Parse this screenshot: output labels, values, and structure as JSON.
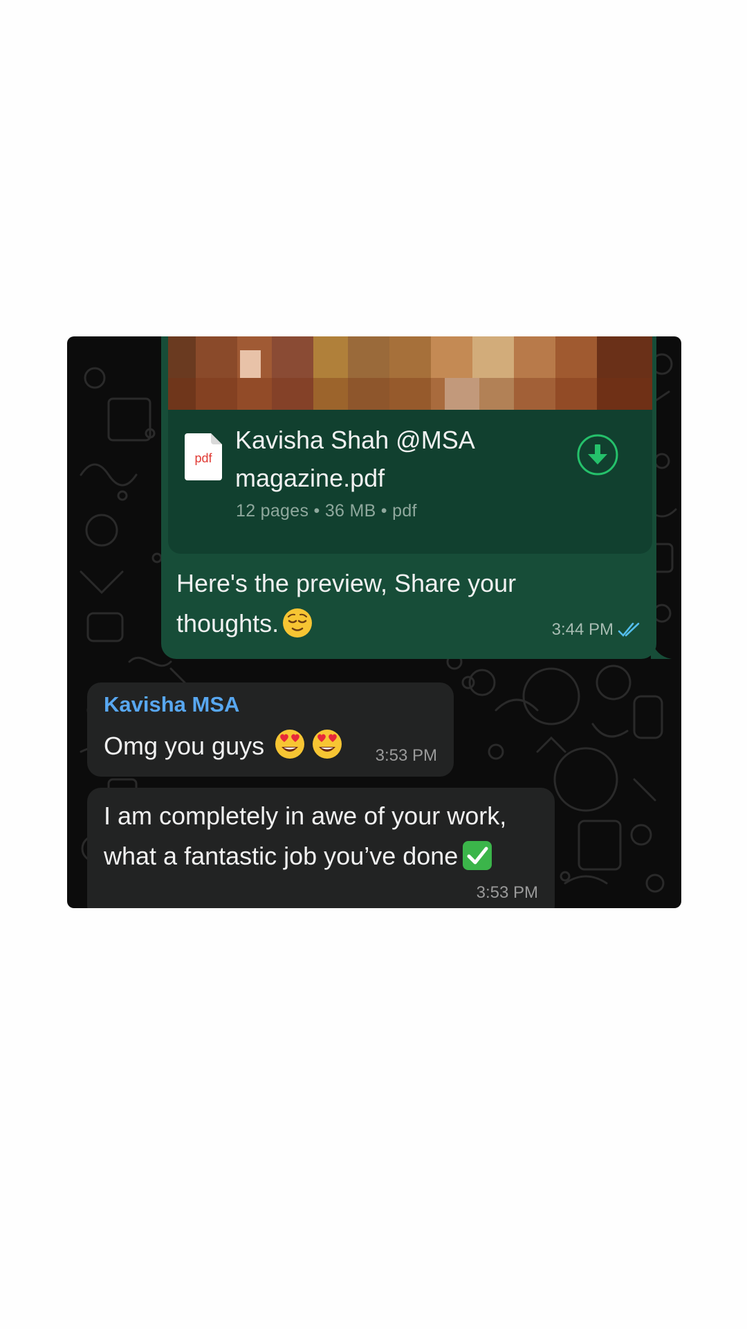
{
  "chat": {
    "outgoing_document": {
      "file_name": "Kavisha Shah @MSA magazine.pdf",
      "file_type_label": "pdf",
      "meta": "12 pages • 36 MB • pdf",
      "caption": "Here's the preview, Share your thoughts.",
      "caption_emoji": "relieved-face",
      "time": "3:44 PM",
      "status": "read",
      "download_icon": "download-arrow-icon"
    },
    "incoming": [
      {
        "sender": "Kavisha MSA",
        "text": "Omg you guys",
        "emojis": [
          "heart-eyes-face",
          "heart-eyes-face"
        ],
        "time": "3:53 PM"
      },
      {
        "text": "I am completely in awe of your work, what a fantastic job you’ve done",
        "emojis": [
          "white-check-mark"
        ],
        "time": "3:53 PM"
      }
    ]
  },
  "colors": {
    "outgoing_bubble": "#174d38",
    "document_card": "#11402f",
    "incoming_bubble": "#222323",
    "sender_name": "#58a7f0",
    "accent_green": "#25c16b",
    "read_ticks": "#53bdeb",
    "chat_background": "#0c0c0c"
  }
}
